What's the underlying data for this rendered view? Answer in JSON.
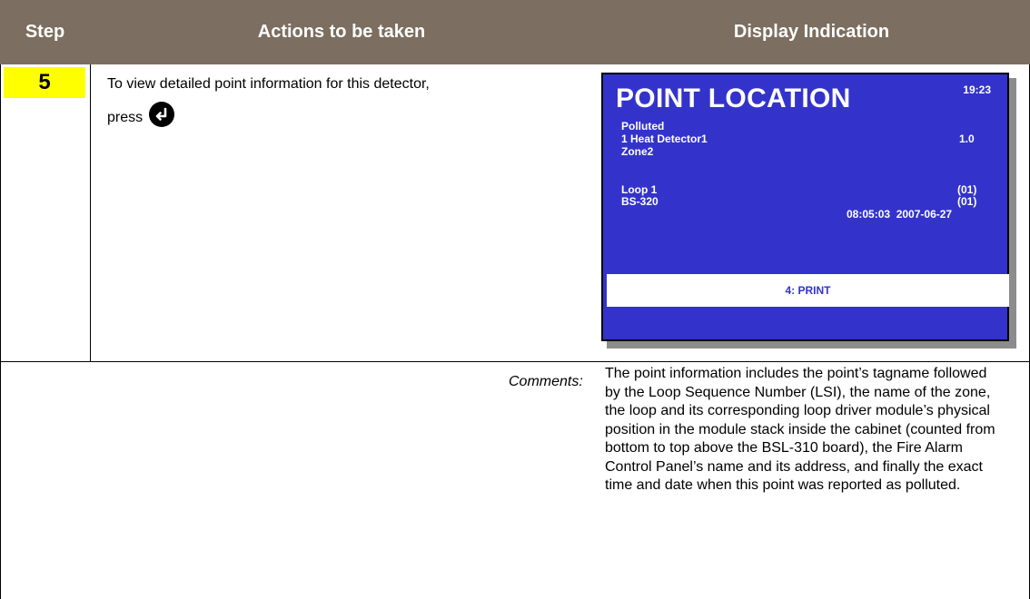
{
  "header": {
    "step": "Step",
    "actions": "Actions to be taken",
    "display": "Display Indication"
  },
  "row": {
    "step_number": "5",
    "action_text": "To view detailed point information for this detector, press",
    "action_icon": "enter-key-icon"
  },
  "display": {
    "title": "POINT LOCATION",
    "time": "19:23",
    "status": "Polluted",
    "point_name": "1 Heat Detector1",
    "point_lsi": "1.0",
    "zone": "Zone2",
    "loop": "Loop 1",
    "loop_position": "(01)",
    "panel": "BS-320",
    "panel_address": "(01)",
    "timestamp": "08:05:03  2007-06-27",
    "softkey": "4: PRINT",
    "colors": {
      "background": "#3333cc",
      "text": "#ffffff",
      "softkey_bg": "#ffffff"
    }
  },
  "comments": {
    "label": "Comments:",
    "text": "The point information includes the point’s tagname followed by the Loop Sequence Number (LSI), the name of the zone, the loop and its corresponding loop driver module’s physical position in the module stack inside the cabinet (counted from bottom to top above the BSL-310 board), the Fire Alarm Control Panel’s name and its address, and finally the exact time and date when this point was reported as polluted."
  },
  "colors": {
    "header_bg": "#7c6e60",
    "step_badge": "#ffff00"
  }
}
